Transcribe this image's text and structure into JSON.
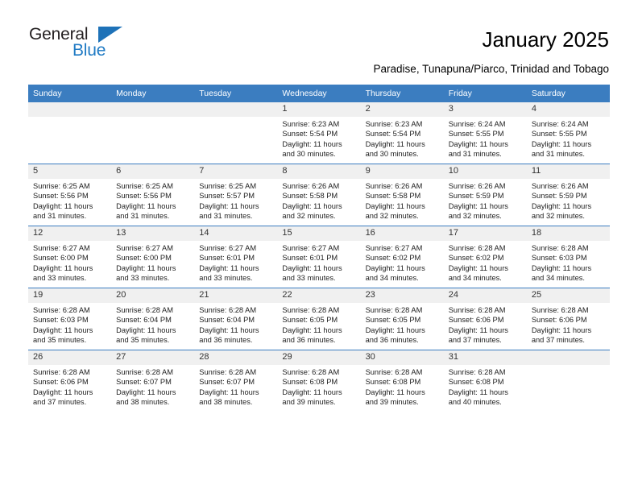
{
  "brand": {
    "name_part1": "General",
    "name_part2": "Blue",
    "accent_color": "#1e72b8",
    "triangle_icon": "triangle-icon"
  },
  "header": {
    "title": "January 2025",
    "subtitle": "Paradise, Tunapuna/Piarco, Trinidad and Tobago"
  },
  "calendar": {
    "header_bg": "#3b7dc0",
    "daynum_bg": "#f0f0f0",
    "weekday_headers": [
      "Sunday",
      "Monday",
      "Tuesday",
      "Wednesday",
      "Thursday",
      "Friday",
      "Saturday"
    ],
    "weeks": [
      [
        {
          "day": "",
          "blank": true,
          "sunrise": "",
          "sunset": "",
          "daylight_line1": "",
          "daylight_line2": ""
        },
        {
          "day": "",
          "blank": true,
          "sunrise": "",
          "sunset": "",
          "daylight_line1": "",
          "daylight_line2": ""
        },
        {
          "day": "",
          "blank": true,
          "sunrise": "",
          "sunset": "",
          "daylight_line1": "",
          "daylight_line2": ""
        },
        {
          "day": "1",
          "blank": false,
          "sunrise": "Sunrise: 6:23 AM",
          "sunset": "Sunset: 5:54 PM",
          "daylight_line1": "Daylight: 11 hours",
          "daylight_line2": "and 30 minutes."
        },
        {
          "day": "2",
          "blank": false,
          "sunrise": "Sunrise: 6:23 AM",
          "sunset": "Sunset: 5:54 PM",
          "daylight_line1": "Daylight: 11 hours",
          "daylight_line2": "and 30 minutes."
        },
        {
          "day": "3",
          "blank": false,
          "sunrise": "Sunrise: 6:24 AM",
          "sunset": "Sunset: 5:55 PM",
          "daylight_line1": "Daylight: 11 hours",
          "daylight_line2": "and 31 minutes."
        },
        {
          "day": "4",
          "blank": false,
          "sunrise": "Sunrise: 6:24 AM",
          "sunset": "Sunset: 5:55 PM",
          "daylight_line1": "Daylight: 11 hours",
          "daylight_line2": "and 31 minutes."
        }
      ],
      [
        {
          "day": "5",
          "blank": false,
          "sunrise": "Sunrise: 6:25 AM",
          "sunset": "Sunset: 5:56 PM",
          "daylight_line1": "Daylight: 11 hours",
          "daylight_line2": "and 31 minutes."
        },
        {
          "day": "6",
          "blank": false,
          "sunrise": "Sunrise: 6:25 AM",
          "sunset": "Sunset: 5:56 PM",
          "daylight_line1": "Daylight: 11 hours",
          "daylight_line2": "and 31 minutes."
        },
        {
          "day": "7",
          "blank": false,
          "sunrise": "Sunrise: 6:25 AM",
          "sunset": "Sunset: 5:57 PM",
          "daylight_line1": "Daylight: 11 hours",
          "daylight_line2": "and 31 minutes."
        },
        {
          "day": "8",
          "blank": false,
          "sunrise": "Sunrise: 6:26 AM",
          "sunset": "Sunset: 5:58 PM",
          "daylight_line1": "Daylight: 11 hours",
          "daylight_line2": "and 32 minutes."
        },
        {
          "day": "9",
          "blank": false,
          "sunrise": "Sunrise: 6:26 AM",
          "sunset": "Sunset: 5:58 PM",
          "daylight_line1": "Daylight: 11 hours",
          "daylight_line2": "and 32 minutes."
        },
        {
          "day": "10",
          "blank": false,
          "sunrise": "Sunrise: 6:26 AM",
          "sunset": "Sunset: 5:59 PM",
          "daylight_line1": "Daylight: 11 hours",
          "daylight_line2": "and 32 minutes."
        },
        {
          "day": "11",
          "blank": false,
          "sunrise": "Sunrise: 6:26 AM",
          "sunset": "Sunset: 5:59 PM",
          "daylight_line1": "Daylight: 11 hours",
          "daylight_line2": "and 32 minutes."
        }
      ],
      [
        {
          "day": "12",
          "blank": false,
          "sunrise": "Sunrise: 6:27 AM",
          "sunset": "Sunset: 6:00 PM",
          "daylight_line1": "Daylight: 11 hours",
          "daylight_line2": "and 33 minutes."
        },
        {
          "day": "13",
          "blank": false,
          "sunrise": "Sunrise: 6:27 AM",
          "sunset": "Sunset: 6:00 PM",
          "daylight_line1": "Daylight: 11 hours",
          "daylight_line2": "and 33 minutes."
        },
        {
          "day": "14",
          "blank": false,
          "sunrise": "Sunrise: 6:27 AM",
          "sunset": "Sunset: 6:01 PM",
          "daylight_line1": "Daylight: 11 hours",
          "daylight_line2": "and 33 minutes."
        },
        {
          "day": "15",
          "blank": false,
          "sunrise": "Sunrise: 6:27 AM",
          "sunset": "Sunset: 6:01 PM",
          "daylight_line1": "Daylight: 11 hours",
          "daylight_line2": "and 33 minutes."
        },
        {
          "day": "16",
          "blank": false,
          "sunrise": "Sunrise: 6:27 AM",
          "sunset": "Sunset: 6:02 PM",
          "daylight_line1": "Daylight: 11 hours",
          "daylight_line2": "and 34 minutes."
        },
        {
          "day": "17",
          "blank": false,
          "sunrise": "Sunrise: 6:28 AM",
          "sunset": "Sunset: 6:02 PM",
          "daylight_line1": "Daylight: 11 hours",
          "daylight_line2": "and 34 minutes."
        },
        {
          "day": "18",
          "blank": false,
          "sunrise": "Sunrise: 6:28 AM",
          "sunset": "Sunset: 6:03 PM",
          "daylight_line1": "Daylight: 11 hours",
          "daylight_line2": "and 34 minutes."
        }
      ],
      [
        {
          "day": "19",
          "blank": false,
          "sunrise": "Sunrise: 6:28 AM",
          "sunset": "Sunset: 6:03 PM",
          "daylight_line1": "Daylight: 11 hours",
          "daylight_line2": "and 35 minutes."
        },
        {
          "day": "20",
          "blank": false,
          "sunrise": "Sunrise: 6:28 AM",
          "sunset": "Sunset: 6:04 PM",
          "daylight_line1": "Daylight: 11 hours",
          "daylight_line2": "and 35 minutes."
        },
        {
          "day": "21",
          "blank": false,
          "sunrise": "Sunrise: 6:28 AM",
          "sunset": "Sunset: 6:04 PM",
          "daylight_line1": "Daylight: 11 hours",
          "daylight_line2": "and 36 minutes."
        },
        {
          "day": "22",
          "blank": false,
          "sunrise": "Sunrise: 6:28 AM",
          "sunset": "Sunset: 6:05 PM",
          "daylight_line1": "Daylight: 11 hours",
          "daylight_line2": "and 36 minutes."
        },
        {
          "day": "23",
          "blank": false,
          "sunrise": "Sunrise: 6:28 AM",
          "sunset": "Sunset: 6:05 PM",
          "daylight_line1": "Daylight: 11 hours",
          "daylight_line2": "and 36 minutes."
        },
        {
          "day": "24",
          "blank": false,
          "sunrise": "Sunrise: 6:28 AM",
          "sunset": "Sunset: 6:06 PM",
          "daylight_line1": "Daylight: 11 hours",
          "daylight_line2": "and 37 minutes."
        },
        {
          "day": "25",
          "blank": false,
          "sunrise": "Sunrise: 6:28 AM",
          "sunset": "Sunset: 6:06 PM",
          "daylight_line1": "Daylight: 11 hours",
          "daylight_line2": "and 37 minutes."
        }
      ],
      [
        {
          "day": "26",
          "blank": false,
          "sunrise": "Sunrise: 6:28 AM",
          "sunset": "Sunset: 6:06 PM",
          "daylight_line1": "Daylight: 11 hours",
          "daylight_line2": "and 37 minutes."
        },
        {
          "day": "27",
          "blank": false,
          "sunrise": "Sunrise: 6:28 AM",
          "sunset": "Sunset: 6:07 PM",
          "daylight_line1": "Daylight: 11 hours",
          "daylight_line2": "and 38 minutes."
        },
        {
          "day": "28",
          "blank": false,
          "sunrise": "Sunrise: 6:28 AM",
          "sunset": "Sunset: 6:07 PM",
          "daylight_line1": "Daylight: 11 hours",
          "daylight_line2": "and 38 minutes."
        },
        {
          "day": "29",
          "blank": false,
          "sunrise": "Sunrise: 6:28 AM",
          "sunset": "Sunset: 6:08 PM",
          "daylight_line1": "Daylight: 11 hours",
          "daylight_line2": "and 39 minutes."
        },
        {
          "day": "30",
          "blank": false,
          "sunrise": "Sunrise: 6:28 AM",
          "sunset": "Sunset: 6:08 PM",
          "daylight_line1": "Daylight: 11 hours",
          "daylight_line2": "and 39 minutes."
        },
        {
          "day": "31",
          "blank": false,
          "sunrise": "Sunrise: 6:28 AM",
          "sunset": "Sunset: 6:08 PM",
          "daylight_line1": "Daylight: 11 hours",
          "daylight_line2": "and 40 minutes."
        },
        {
          "day": "",
          "blank": true,
          "sunrise": "",
          "sunset": "",
          "daylight_line1": "",
          "daylight_line2": ""
        }
      ]
    ]
  }
}
